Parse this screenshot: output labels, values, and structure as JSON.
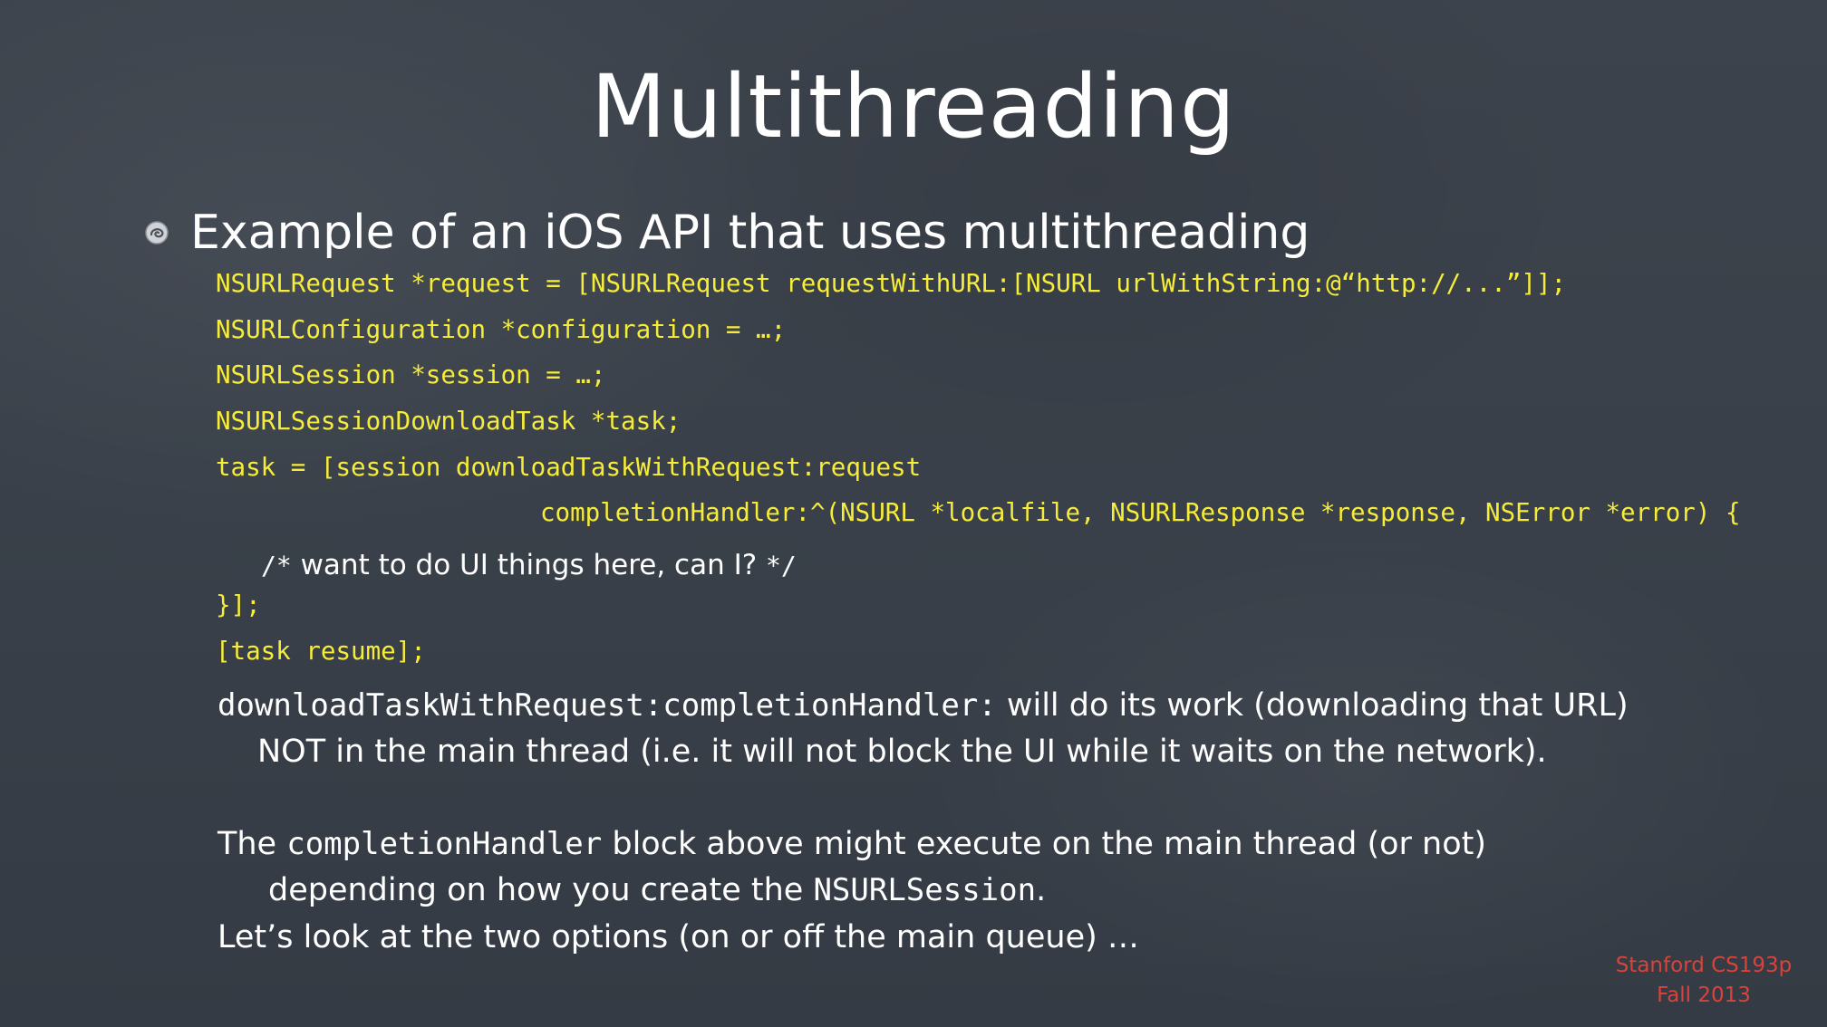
{
  "slide": {
    "title": "Multithreading",
    "bullet_heading": "Example of an iOS API that uses multithreading"
  },
  "code": {
    "line1": "NSURLRequest *request = [NSURLRequest requestWithURL:[NSURL urlWithString:@“http://...”]];",
    "line2": "NSURLConfiguration *configuration = …;",
    "line3": "NSURLSession *session = …;",
    "line4": "NSURLSessionDownloadTask *task;",
    "line5": "task = [session downloadTaskWithRequest:request",
    "line6": "completionHandler:^(NSURL *localfile, NSURLResponse *response, NSError *error) {",
    "comment_open": "/*",
    "comment_text": " want to do UI things here, can I? ",
    "comment_close": "*/",
    "line8": "}];",
    "line9": "[task resume];"
  },
  "explanation": {
    "p1_code": "downloadTaskWithRequest:completionHandler:",
    "p1_text": " will do its work (downloading that URL)",
    "p1_line2": "NOT in the main thread (i.e. it will not block the UI while it waits on the network).",
    "p2_prefix": "The ",
    "p2_code": "completionHandler",
    "p2_text": " block above might execute on the main thread (or not)",
    "p2_line2_text": "depending on how you create the ",
    "p2_line2_code": "NSURLSession",
    "p2_line2_end": ".",
    "p3": "Let’s look at the two options (on or off the main queue) …"
  },
  "credit": {
    "line1": "Stanford CS193p",
    "line2": "Fall 2013"
  },
  "colors": {
    "background": "#3a4049",
    "code": "#f6ec3a",
    "text": "#ffffff",
    "credit": "#d9433c"
  }
}
